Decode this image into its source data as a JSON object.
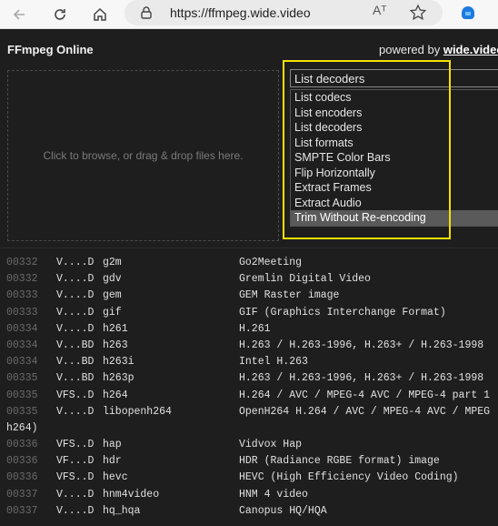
{
  "browser": {
    "url": "https://ffmpeg.wide.video",
    "read_aloud": "Aᵀ"
  },
  "header": {
    "title": "FFmpeg Online",
    "powered_prefix": "powered by ",
    "powered_brand": "wide.video"
  },
  "dropzone": {
    "text": "Click to browse, or drag & drop files here."
  },
  "command_select": {
    "value": "List decoders",
    "options": [
      "List codecs",
      "List encoders",
      "List decoders",
      "List formats",
      "SMPTE Color Bars",
      "Flip Horizontally",
      "Extract Frames",
      "Extract Audio",
      "Trim Without Re-encoding"
    ],
    "hovered_index": 8
  },
  "log": [
    {
      "ts": "00332",
      "flags": "V....D",
      "name": "g2m",
      "desc": "Go2Meeting"
    },
    {
      "ts": "00332",
      "flags": "V....D",
      "name": "gdv",
      "desc": "Gremlin Digital Video"
    },
    {
      "ts": "00333",
      "flags": "V....D",
      "name": "gem",
      "desc": "GEM Raster image"
    },
    {
      "ts": "00333",
      "flags": "V....D",
      "name": "gif",
      "desc": "GIF (Graphics Interchange Format)"
    },
    {
      "ts": "00334",
      "flags": "V....D",
      "name": "h261",
      "desc": "H.261"
    },
    {
      "ts": "00334",
      "flags": "V...BD",
      "name": "h263",
      "desc": "H.263 / H.263-1996, H.263+ / H.263-1998"
    },
    {
      "ts": "00334",
      "flags": "V...BD",
      "name": "h263i",
      "desc": "Intel H.263"
    },
    {
      "ts": "00335",
      "flags": "V...BD",
      "name": "h263p",
      "desc": "H.263 / H.263-1996, H.263+ / H.263-1998"
    },
    {
      "ts": "00335",
      "flags": "VFS..D",
      "name": "h264",
      "desc": "H.264 / AVC / MPEG-4 AVC / MPEG-4 part 1"
    },
    {
      "ts": "00335",
      "flags": "V....D",
      "name": "libopenh264",
      "desc": "OpenH264 H.264 / AVC / MPEG-4 AVC / MPEG"
    },
    {
      "ts": "",
      "flags": "",
      "name": "",
      "desc": "h264)",
      "wrap": true
    },
    {
      "ts": "00336",
      "flags": "VFS..D",
      "name": "hap",
      "desc": "Vidvox Hap"
    },
    {
      "ts": "00336",
      "flags": "VF...D",
      "name": "hdr",
      "desc": "HDR (Radiance RGBE format) image"
    },
    {
      "ts": "00336",
      "flags": "VFS..D",
      "name": "hevc",
      "desc": "HEVC (High Efficiency Video Coding)"
    },
    {
      "ts": "00337",
      "flags": "V....D",
      "name": "hnm4video",
      "desc": "HNM 4 video"
    },
    {
      "ts": "00337",
      "flags": "V....D",
      "name": "hq_hqa",
      "desc": "Canopus HQ/HQA"
    }
  ],
  "colors": {
    "highlight": "#f5e000",
    "background": "#1e1e1e"
  }
}
